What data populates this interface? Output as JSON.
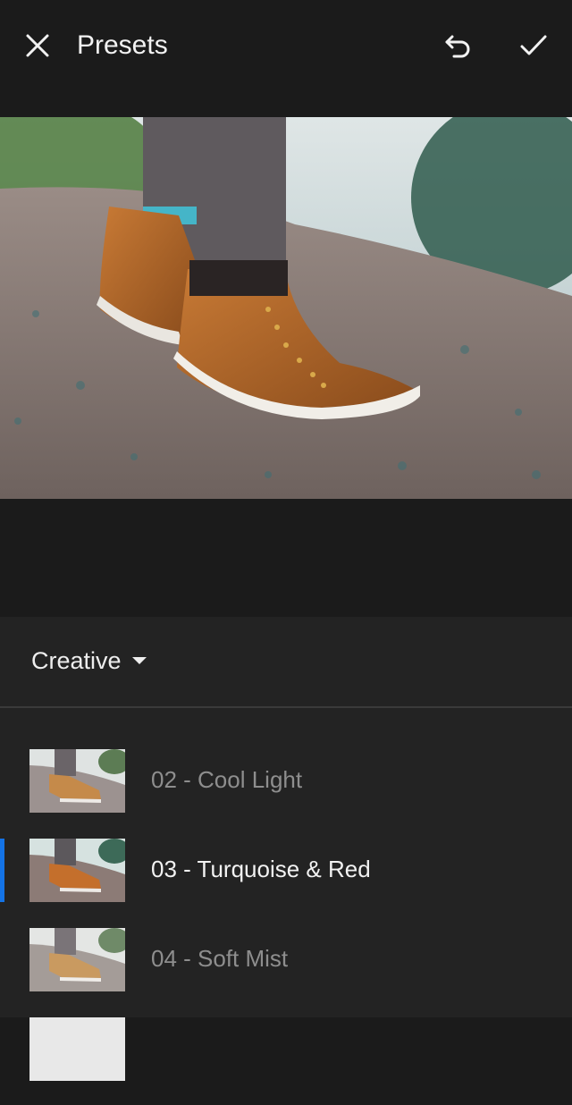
{
  "header": {
    "title": "Presets",
    "close_icon": "close-icon",
    "undo_icon": "undo-icon",
    "done_icon": "checkmark-icon"
  },
  "photo": {
    "subject": "orange high-top sneakers on gravel"
  },
  "panel": {
    "category": "Creative",
    "category_icon": "caret-down-icon",
    "presets": [
      {
        "label": "02 - Cool Light",
        "selected": false
      },
      {
        "label": "03 - Turquoise & Red",
        "selected": true
      },
      {
        "label": "04 - Soft Mist",
        "selected": false
      }
    ]
  },
  "colors": {
    "background": "#1b1b1b",
    "panel": "#232323",
    "selection_accent": "#1473e6",
    "inactive_text": "#8e8e8e"
  }
}
